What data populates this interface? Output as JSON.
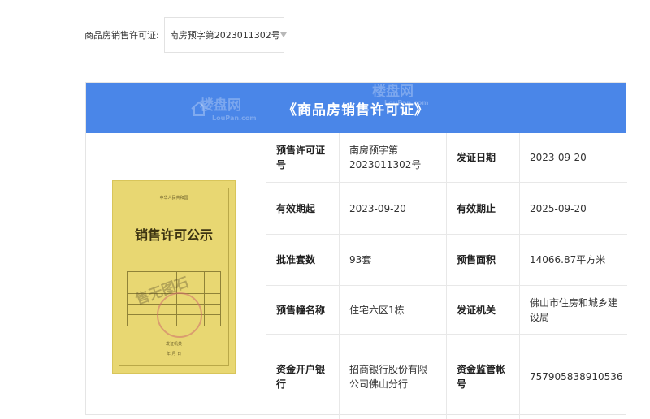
{
  "filter": {
    "label": "商品房销售许可证:",
    "selected": "南房预字第2023011302号"
  },
  "panel": {
    "title": "《商品房销售许可证》",
    "watermark_text": "楼盘网",
    "watermark_sub": "LouPan.com"
  },
  "certificate": {
    "top_text": "中华人民共和国",
    "heading": "销售许可公示",
    "watermark": "售无图石",
    "issuer_text": "发证机关",
    "date_text": "年 月 日"
  },
  "details": [
    {
      "k1": "预售许可证号",
      "v1": "南房预字第2023011302号",
      "k2": "发证日期",
      "v2": "2023-09-20"
    },
    {
      "k1": "有效期起",
      "v1": "2023-09-20",
      "k2": "有效期止",
      "v2": "2025-09-20"
    },
    {
      "k1": "批准套数",
      "v1": "93套",
      "k2": "预售面积",
      "v2": "14066.87平方米"
    },
    {
      "k1": "预售幢名称",
      "v1": "住宅六区1栋",
      "k2": "发证机关",
      "v2": "佛山市住房和城乡建设局"
    },
    {
      "k1": "资金开户银行",
      "v1": "招商银行股份有限公司佛山分行",
      "k2": "资金监管帐号",
      "v2": "757905838910536"
    }
  ],
  "colors": {
    "header_blue": "#4a86e8",
    "cert_yellow": "#e8d772"
  }
}
